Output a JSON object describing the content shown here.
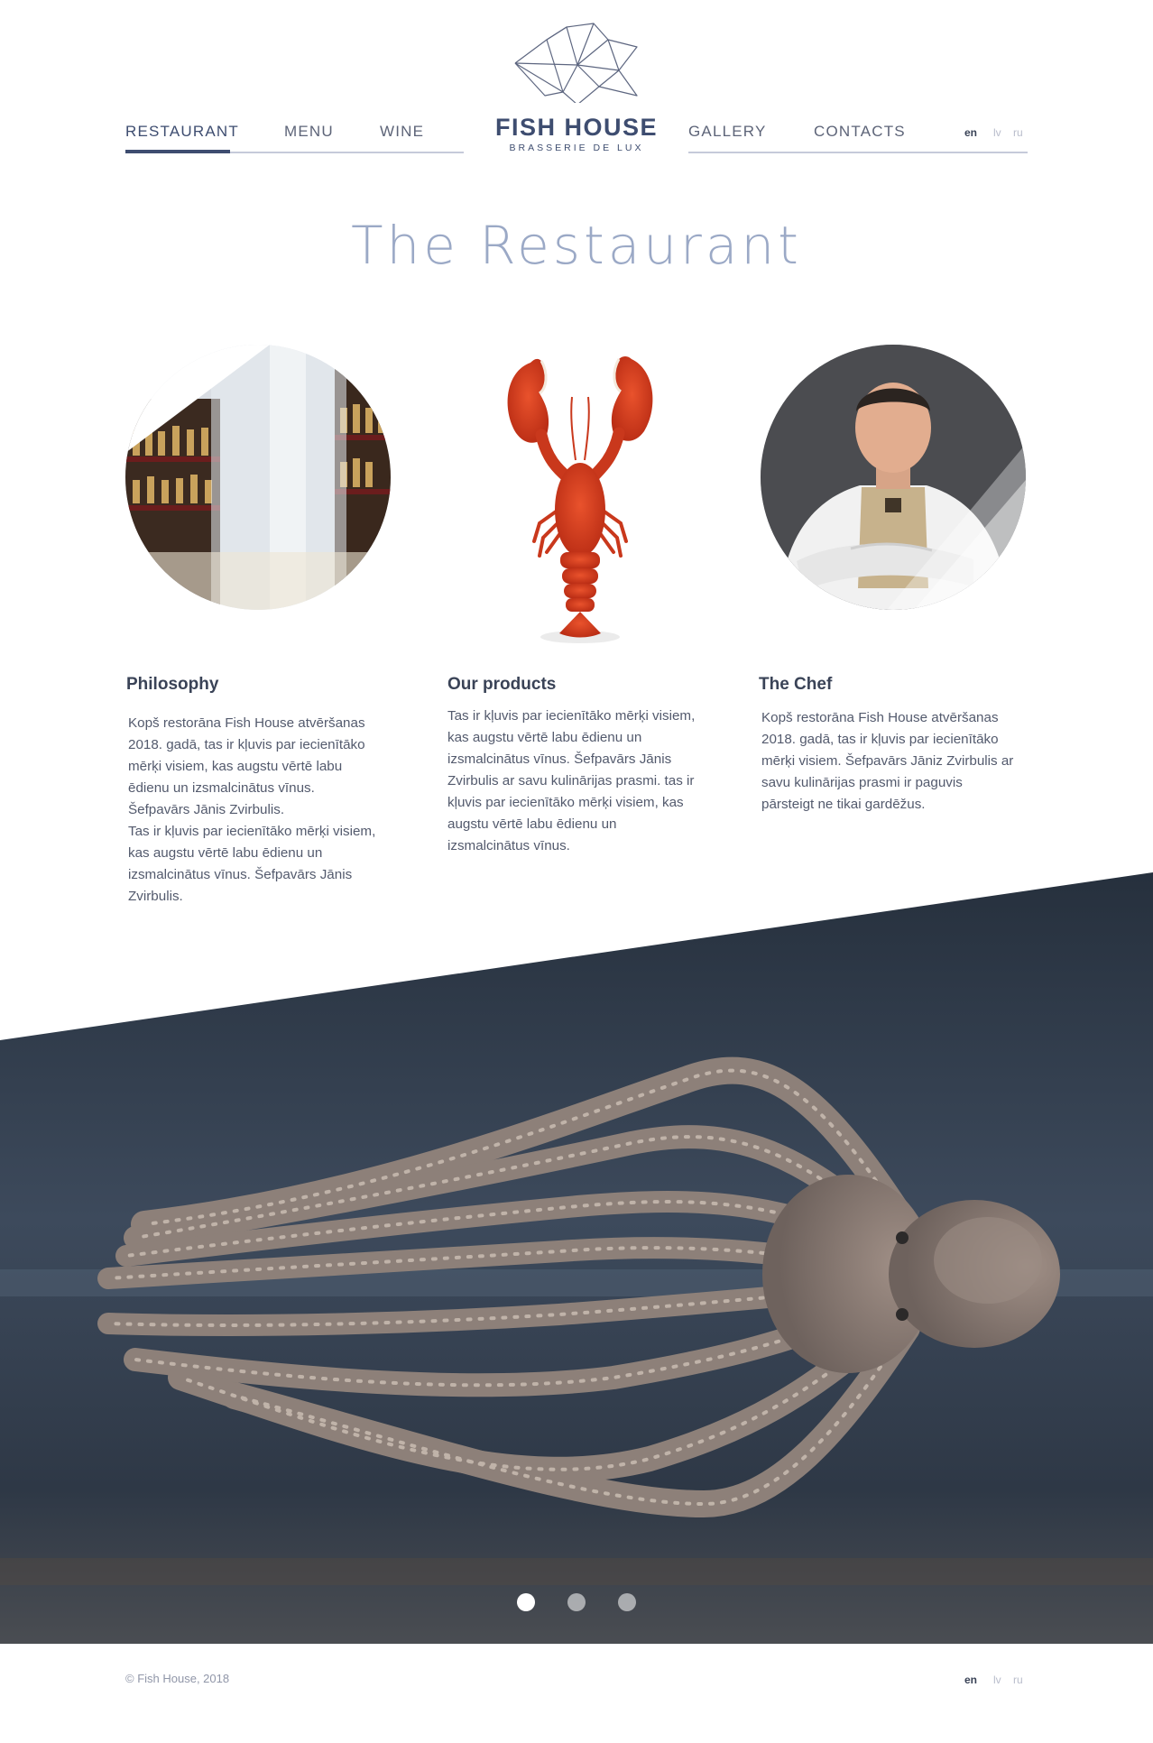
{
  "nav": {
    "left": [
      {
        "label": "RESTAURANT",
        "active": true
      },
      {
        "label": "MENU"
      },
      {
        "label": "WINE"
      }
    ],
    "right": [
      {
        "label": "GALLERY"
      },
      {
        "label": "CONTACTS"
      }
    ],
    "languages": [
      "en",
      "lv",
      "ru"
    ],
    "active_language": "en"
  },
  "logo": {
    "title": "FISH HOUSE",
    "subtitle": "BRASSERIE DE LUX",
    "icon": "geometric-fish-icon"
  },
  "page_title": "The Restaurant",
  "images": {
    "restaurant": "restaurant-interior-photo",
    "product": "lobster-photo",
    "chef": "chef-portrait-photo",
    "hero": "octopus-photo"
  },
  "columns": [
    {
      "heading": "Philosophy",
      "text": "Kopš restorāna Fish House atvēršanas\n2018. gadā, tas ir kļuvis par iecienītāko\nmērķi visiem, kas augstu vērtē labu\nēdienu un izsmalcinātus vīnus.\nŠefpavārs Jānis Zvirbulis.\nTas ir kļuvis par iecienītāko mērķi visiem,\nkas augstu vērtē labu ēdienu un\nizsmalcinātus vīnus. Šefpavārs Jānis\nZvirbulis."
    },
    {
      "heading": "Our products",
      "text": "Tas ir kļuvis par iecienītāko mērķi visiem,\nkas augstu vērtē labu ēdienu un\nizsmalcinātus vīnus. Šefpavārs Jānis\nZvirbulis ar savu kulinārijas prasmi. tas ir\nkļuvis par iecienītāko mērķi visiem, kas\naugstu vērtē labu ēdienu un\nizsmalcinātus vīnus."
    },
    {
      "heading": "The Chef",
      "text": "Kopš restorāna Fish House atvēršanas\n2018. gadā, tas ir kļuvis par iecienītāko\nmērķi visiem. Šefpavārs Jāniz Zvirbulis ar\nsavu kulinārijas prasmi ir paguvis\npārsteigt ne tikai gardēžus."
    }
  ],
  "slider": {
    "count": 3,
    "active": 1
  },
  "footer": {
    "copyright": "© Fish House, 2018",
    "languages": [
      "en",
      "lv",
      "ru"
    ]
  },
  "colors": {
    "brand": "#3e4d70",
    "title": "#9ba9c6",
    "text": "#535a6d",
    "hero_background": "#2c3a4c"
  }
}
